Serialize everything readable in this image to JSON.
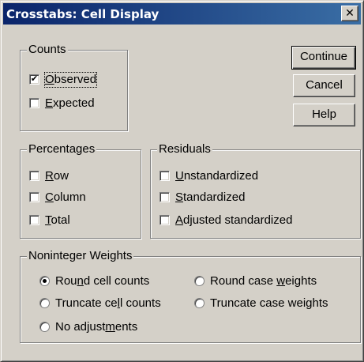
{
  "window": {
    "title": "Crosstabs: Cell Display",
    "close_glyph": "✕"
  },
  "buttons": {
    "continue": "Continue",
    "cancel": "Cancel",
    "help": "Help"
  },
  "counts": {
    "legend": "Counts",
    "items": [
      {
        "pre": "",
        "mn": "O",
        "post": "bserved",
        "checked": true
      },
      {
        "pre": "",
        "mn": "E",
        "post": "xpected",
        "checked": false
      }
    ]
  },
  "percentages": {
    "legend": "Percentages",
    "items": [
      {
        "pre": "",
        "mn": "R",
        "post": "ow",
        "checked": false
      },
      {
        "pre": "",
        "mn": "C",
        "post": "olumn",
        "checked": false
      },
      {
        "pre": "",
        "mn": "T",
        "post": "otal",
        "checked": false
      }
    ]
  },
  "residuals": {
    "legend": "Residuals",
    "items": [
      {
        "pre": "",
        "mn": "U",
        "post": "nstandardized",
        "checked": false
      },
      {
        "pre": "",
        "mn": "S",
        "post": "tandardized",
        "checked": false
      },
      {
        "pre": "",
        "mn": "A",
        "post": "djusted standardized",
        "checked": false
      }
    ]
  },
  "weights": {
    "legend": "Noninteger Weights",
    "options": [
      {
        "pre": "Rou",
        "mn": "n",
        "post": "d cell counts",
        "selected": true
      },
      {
        "pre": "Round case ",
        "mn": "w",
        "post": "eights",
        "selected": false
      },
      {
        "pre": "Truncate ce",
        "mn": "l",
        "post": "l counts",
        "selected": false
      },
      {
        "pre": "Truncate case wei",
        "mn": "g",
        "post": "hts",
        "selected": false
      },
      {
        "pre": "No adjust",
        "mn": "m",
        "post": "ents",
        "selected": false
      }
    ]
  }
}
